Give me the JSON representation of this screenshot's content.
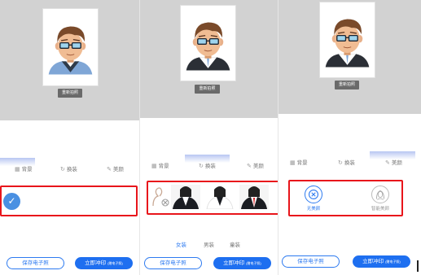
{
  "screens": [
    {
      "retake_label": "重新拍照",
      "tabs": [
        {
          "icon": "▦",
          "label": "背景"
        },
        {
          "icon": "↻",
          "label": "换装"
        },
        {
          "icon": "✎",
          "label": "美颜"
        }
      ],
      "selected_icon": "✓",
      "save_label": "保存电子照",
      "print_label": "立即冲印",
      "print_note": "(赠电子照)"
    },
    {
      "retake_label": "重新拍照",
      "tabs": [
        {
          "icon": "▦",
          "label": "背景"
        },
        {
          "icon": "↻",
          "label": "换装"
        },
        {
          "icon": "✎",
          "label": "美颜"
        }
      ],
      "subtabs": [
        "女装",
        "男装",
        "童装"
      ],
      "save_label": "保存电子照",
      "print_label": "立即冲印",
      "print_note": "(赠电子照)"
    },
    {
      "retake_label": "重新拍照",
      "tabs": [
        {
          "icon": "▦",
          "label": "背景"
        },
        {
          "icon": "↻",
          "label": "换装"
        },
        {
          "icon": "✎",
          "label": "美颜"
        }
      ],
      "beauty_options": [
        "无美颜",
        "智能美颜"
      ],
      "save_label": "保存电子照",
      "print_label": "立即冲印",
      "print_note": "(赠电子照)"
    }
  ],
  "colors": {
    "accent": "#2d7af0",
    "highlight_box": "#e8151b",
    "photo_bg": "#d2d2d2"
  }
}
